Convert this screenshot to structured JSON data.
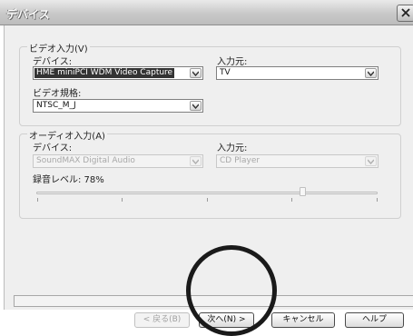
{
  "window": {
    "title": "デバイス"
  },
  "video": {
    "legend": "ビデオ入力(V)",
    "device_label": "デバイス:",
    "device_value": "HME miniPCI WDM Video Capture",
    "input_source_label": "入力元:",
    "input_source_value": "TV",
    "standard_label": "ビデオ規格:",
    "standard_value": "NTSC_M_J"
  },
  "audio": {
    "legend": "オーディオ入力(A)",
    "device_label": "デバイス:",
    "device_value": "SoundMAX Digital Audio",
    "input_source_label": "入力元:",
    "input_source_value": "CD Player",
    "level_label": "録音レベル: 78%",
    "level_percent": 78
  },
  "buttons": {
    "back": "< 戻る(B)",
    "next": "次へ(N) >",
    "cancel": "キャンセル",
    "help": "ヘルプ"
  },
  "icons": {
    "close": "close-icon",
    "dropdown": "chevron-down-icon"
  }
}
